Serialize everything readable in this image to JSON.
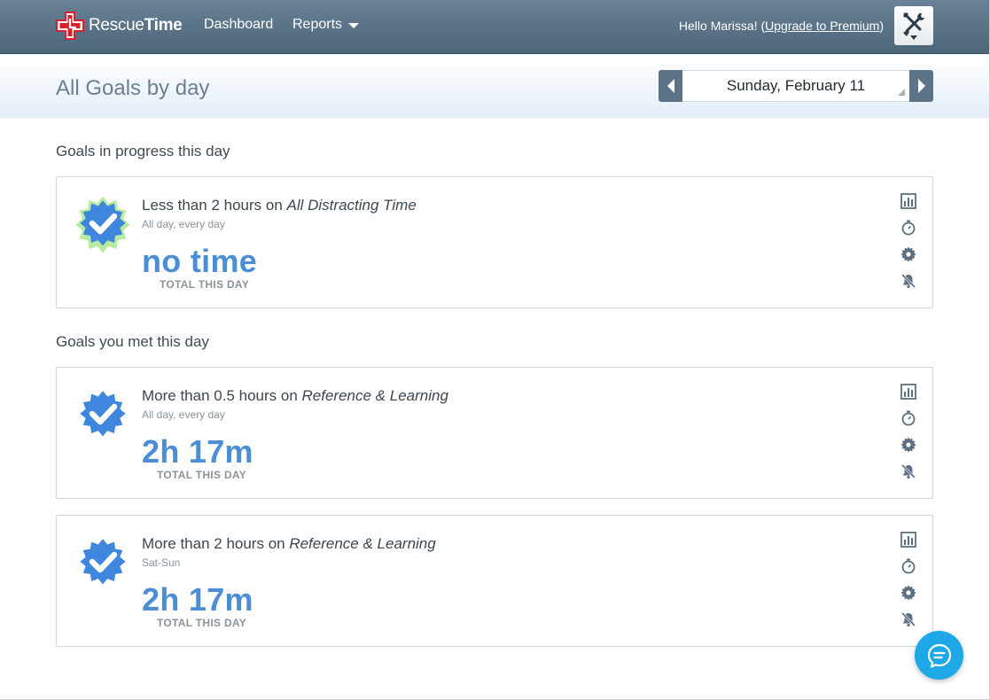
{
  "app": {
    "logo_text_light": "Rescue",
    "logo_text_bold": "Time",
    "brand_color": "#d9202b"
  },
  "nav": {
    "dashboard": "Dashboard",
    "reports": "Reports"
  },
  "user": {
    "hello": "Hello Marissa! (",
    "upgrade": "Upgrade to Premium",
    "close_paren": ")"
  },
  "page": {
    "title": "All Goals by day",
    "date": "Sunday, February 11"
  },
  "sections": {
    "in_progress": "Goals in progress this day",
    "met": "Goals you met this day"
  },
  "goals": [
    {
      "prefix": "Less than 2 hours on ",
      "category": "All Distracting Time",
      "schedule": "All day, every day",
      "total": "no time",
      "total_label": "TOTAL THIS DAY",
      "status": "in-progress"
    },
    {
      "prefix": "More than 0.5 hours on ",
      "category": "Reference & Learning",
      "schedule": "All day, every day",
      "total": "2h 17m",
      "total_label": "TOTAL THIS DAY",
      "status": "met"
    },
    {
      "prefix": "More than 2 hours on ",
      "category": "Reference & Learning",
      "schedule": "Sat-Sun",
      "total": "2h 17m",
      "total_label": "TOTAL THIS DAY",
      "status": "met"
    }
  ],
  "card_icons": [
    "bar-chart-icon",
    "stopwatch-icon",
    "gear-icon",
    "bell-off-icon"
  ],
  "colors": {
    "accent_blue": "#4a8ed8",
    "badge_glow": "#b6ec9f",
    "nav_bg": "#5b7387",
    "chat_blue": "#1ea8e7"
  }
}
